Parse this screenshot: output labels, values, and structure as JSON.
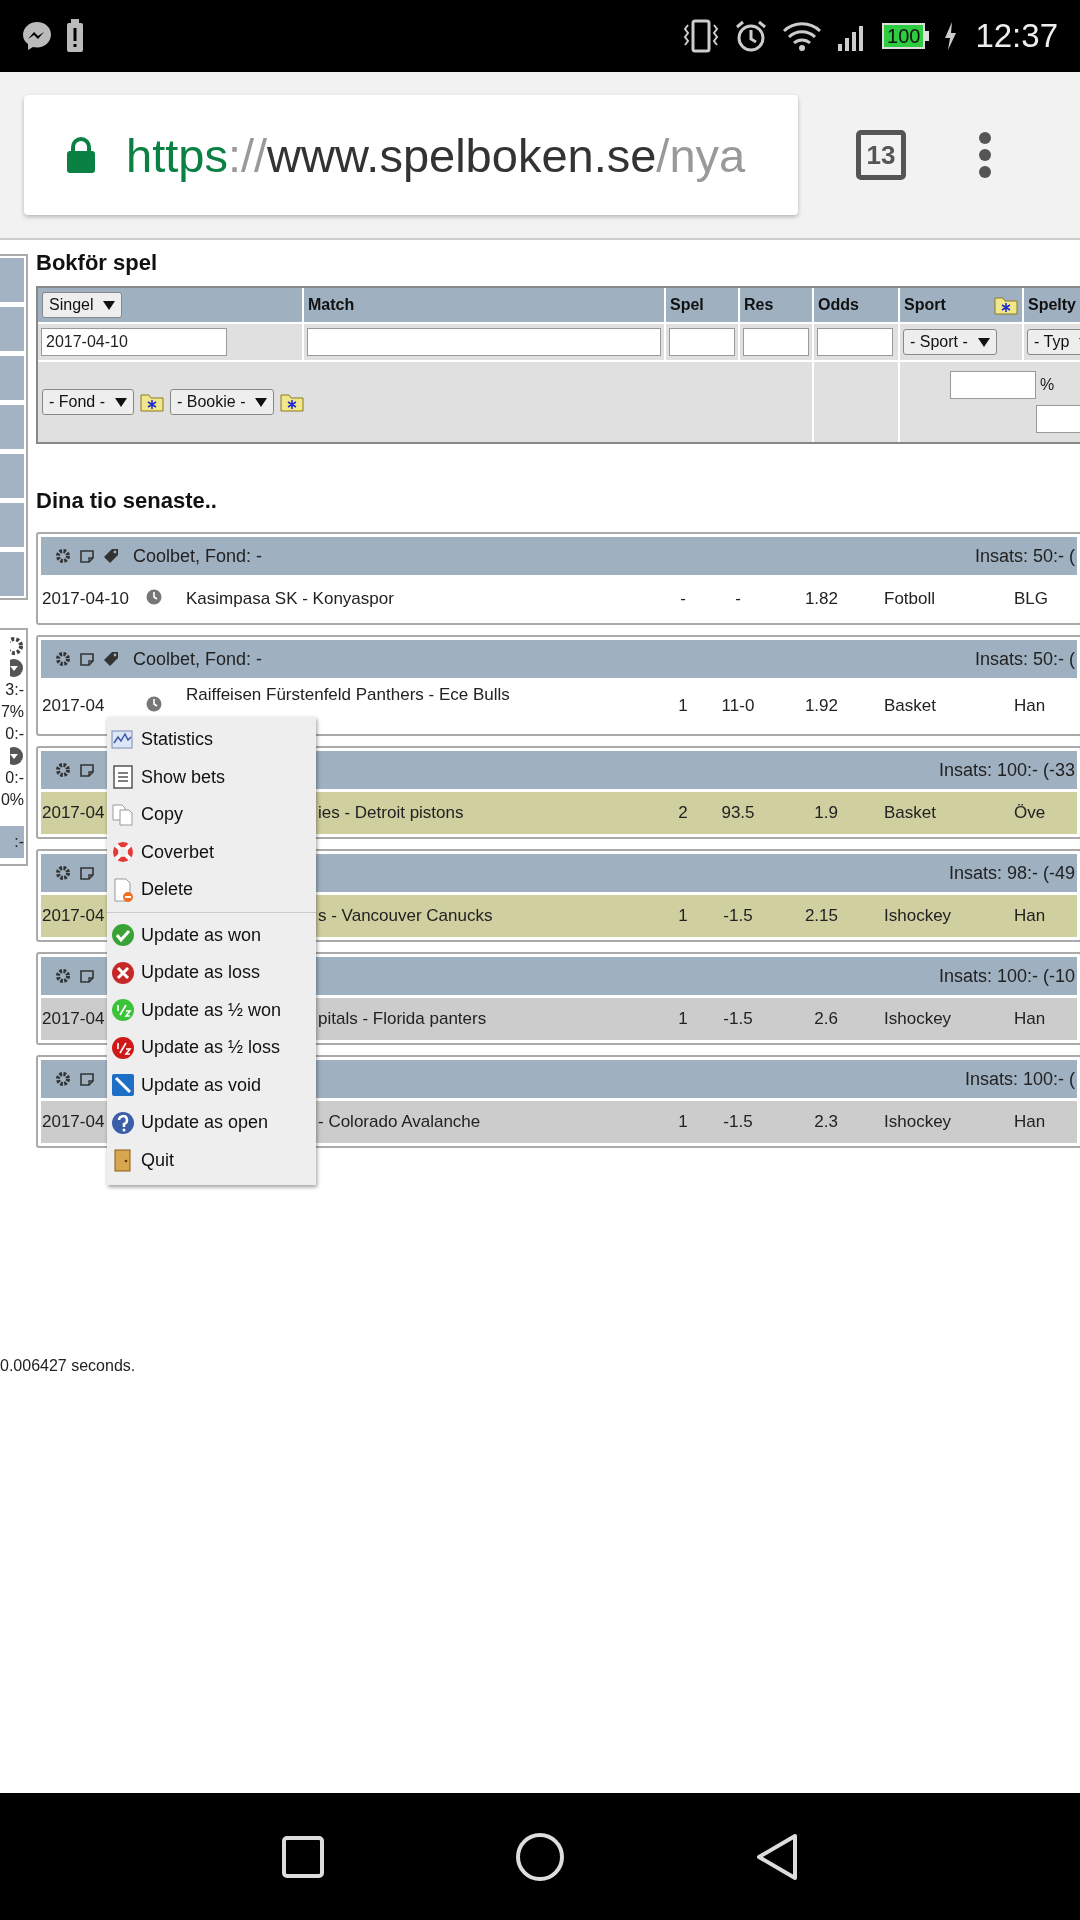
{
  "status_bar": {
    "battery": "100",
    "time": "12:37"
  },
  "browser": {
    "url": {
      "scheme": "https",
      "separator": "://",
      "host": "www.spelboken.se",
      "path": "/nya"
    },
    "tab_count": "13"
  },
  "side_panel": {
    "values": [
      "3:-",
      "7%",
      "0:-",
      "0:-",
      "0%",
      ":-"
    ]
  },
  "form": {
    "title": "Bokför spel",
    "bet_kind": "Singel",
    "columns": [
      "Match",
      "Spel",
      "Res",
      "Odds",
      "Sport",
      "Spelty"
    ],
    "date": "2017-04-10",
    "sport_select": "- Sport -",
    "type_select": "- Typ",
    "fund_select": "- Fond -",
    "bookie_select": "- Bookie -",
    "percent_label": "%"
  },
  "recent": {
    "title": "Dina tio senaste..",
    "bets": [
      {
        "title": "Coolbet, Fond: -",
        "stake": "Insats: 50:- (",
        "date": "2017-04-10",
        "clock": true,
        "covered": false,
        "match": "Kasimpasa SK - Konyaspor",
        "pick": "-",
        "result": "-",
        "odds": "1.82",
        "sport": "Fotboll",
        "bet_type": "BLG",
        "color": "#ffffff"
      },
      {
        "title": "Coolbet, Fond: -",
        "stake": "Insats: 50:- (",
        "date": "2017-04",
        "clock": true,
        "covered": false,
        "match": "Raiffeisen Fürstenfeld Panthers - Ece Bulls",
        "pick": "1",
        "result": "11-0",
        "odds": "1.92",
        "sport": "Basket",
        "bet_type": "Han",
        "color": "#ffffff"
      },
      {
        "stake": "Insats: 100:- (-33",
        "date": "2017-04",
        "clock": false,
        "covered": true,
        "match": "ies - Detroit pistons",
        "pick": "2",
        "result": "93.5",
        "odds": "1.9",
        "sport": "Basket",
        "bet_type": "Öve",
        "color": "#cfcf9f"
      },
      {
        "stake": "Insats: 98:- (-49",
        "date": "2017-04",
        "clock": false,
        "covered": true,
        "match": "s - Vancouver Canucks",
        "pick": "1",
        "result": "-1.5",
        "odds": "2.15",
        "sport": "Ishockey",
        "bet_type": "Han",
        "color": "#cfcf9f"
      },
      {
        "stake": "Insats: 100:- (-10",
        "date": "2017-04",
        "clock": false,
        "covered": true,
        "match": "pitals - Florida panters",
        "pick": "1",
        "result": "-1.5",
        "odds": "2.6",
        "sport": "Ishockey",
        "bet_type": "Han",
        "color": "#cccccc"
      },
      {
        "stake": "Insats: 100:- (",
        "date": "2017-04",
        "clock": false,
        "covered": true,
        "match": "- Colorado Avalanche",
        "pick": "1",
        "result": "-1.5",
        "odds": "2.3",
        "sport": "Ishockey",
        "bet_type": "Han",
        "color": "#cccccc"
      }
    ]
  },
  "context_menu": {
    "items": [
      {
        "kind": "statistics",
        "label": "Statistics"
      },
      {
        "kind": "list",
        "label": "Show bets"
      },
      {
        "kind": "copy",
        "label": "Copy"
      },
      {
        "kind": "coverbet",
        "label": "Coverbet"
      },
      {
        "kind": "delete",
        "label": "Delete",
        "divider_after": true
      },
      {
        "kind": "won",
        "label": "Update as won"
      },
      {
        "kind": "loss",
        "label": "Update as loss"
      },
      {
        "kind": "halfwon",
        "label": "Update as ½ won"
      },
      {
        "kind": "halfloss",
        "label": "Update as ½ loss"
      },
      {
        "kind": "void",
        "label": "Update as void"
      },
      {
        "kind": "open",
        "label": "Update as open"
      },
      {
        "kind": "quit",
        "label": "Quit"
      }
    ]
  },
  "footer": "0.006427 seconds."
}
